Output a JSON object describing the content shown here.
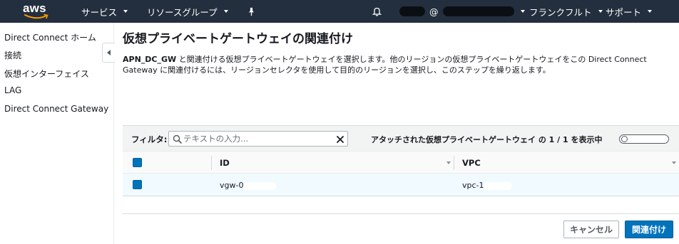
{
  "nav": {
    "logo": "aws",
    "services": "サービス",
    "resource_groups": "リソースグループ",
    "account_at": "@",
    "region": "フランクフルト",
    "support": "サポート"
  },
  "sidebar": {
    "items": [
      {
        "label": "Direct Connect ホーム"
      },
      {
        "label": "接続"
      },
      {
        "label": "仮想インターフェイス"
      },
      {
        "label": "LAG"
      },
      {
        "label": "Direct Connect Gateway"
      }
    ]
  },
  "main": {
    "title": "仮想プライベートゲートウェイの関連付け",
    "gateway_name": "APN_DC_GW",
    "desc_line1": " と関連付ける仮想プライベートゲートウェイを選択します。他のリージョンの仮想プライベートゲートウェイをこの Direct Connect",
    "desc_line2": "Gateway に関連付けるには、リージョンセレクタを使用して目的のリージョンを選択し、このステップを繰り返します。"
  },
  "filter": {
    "label": "フィルタ:",
    "placeholder": "テキストの入力...",
    "count_text": "アタッチされた仮想プライベートゲートウェイ の 1 / 1 を表示中"
  },
  "table": {
    "columns": [
      "ID",
      "VPC"
    ],
    "rows": [
      {
        "id": "vgw-0",
        "vpc": "vpc-1"
      }
    ]
  },
  "buttons": {
    "cancel": "キャンセル",
    "associate": "関連付け"
  }
}
